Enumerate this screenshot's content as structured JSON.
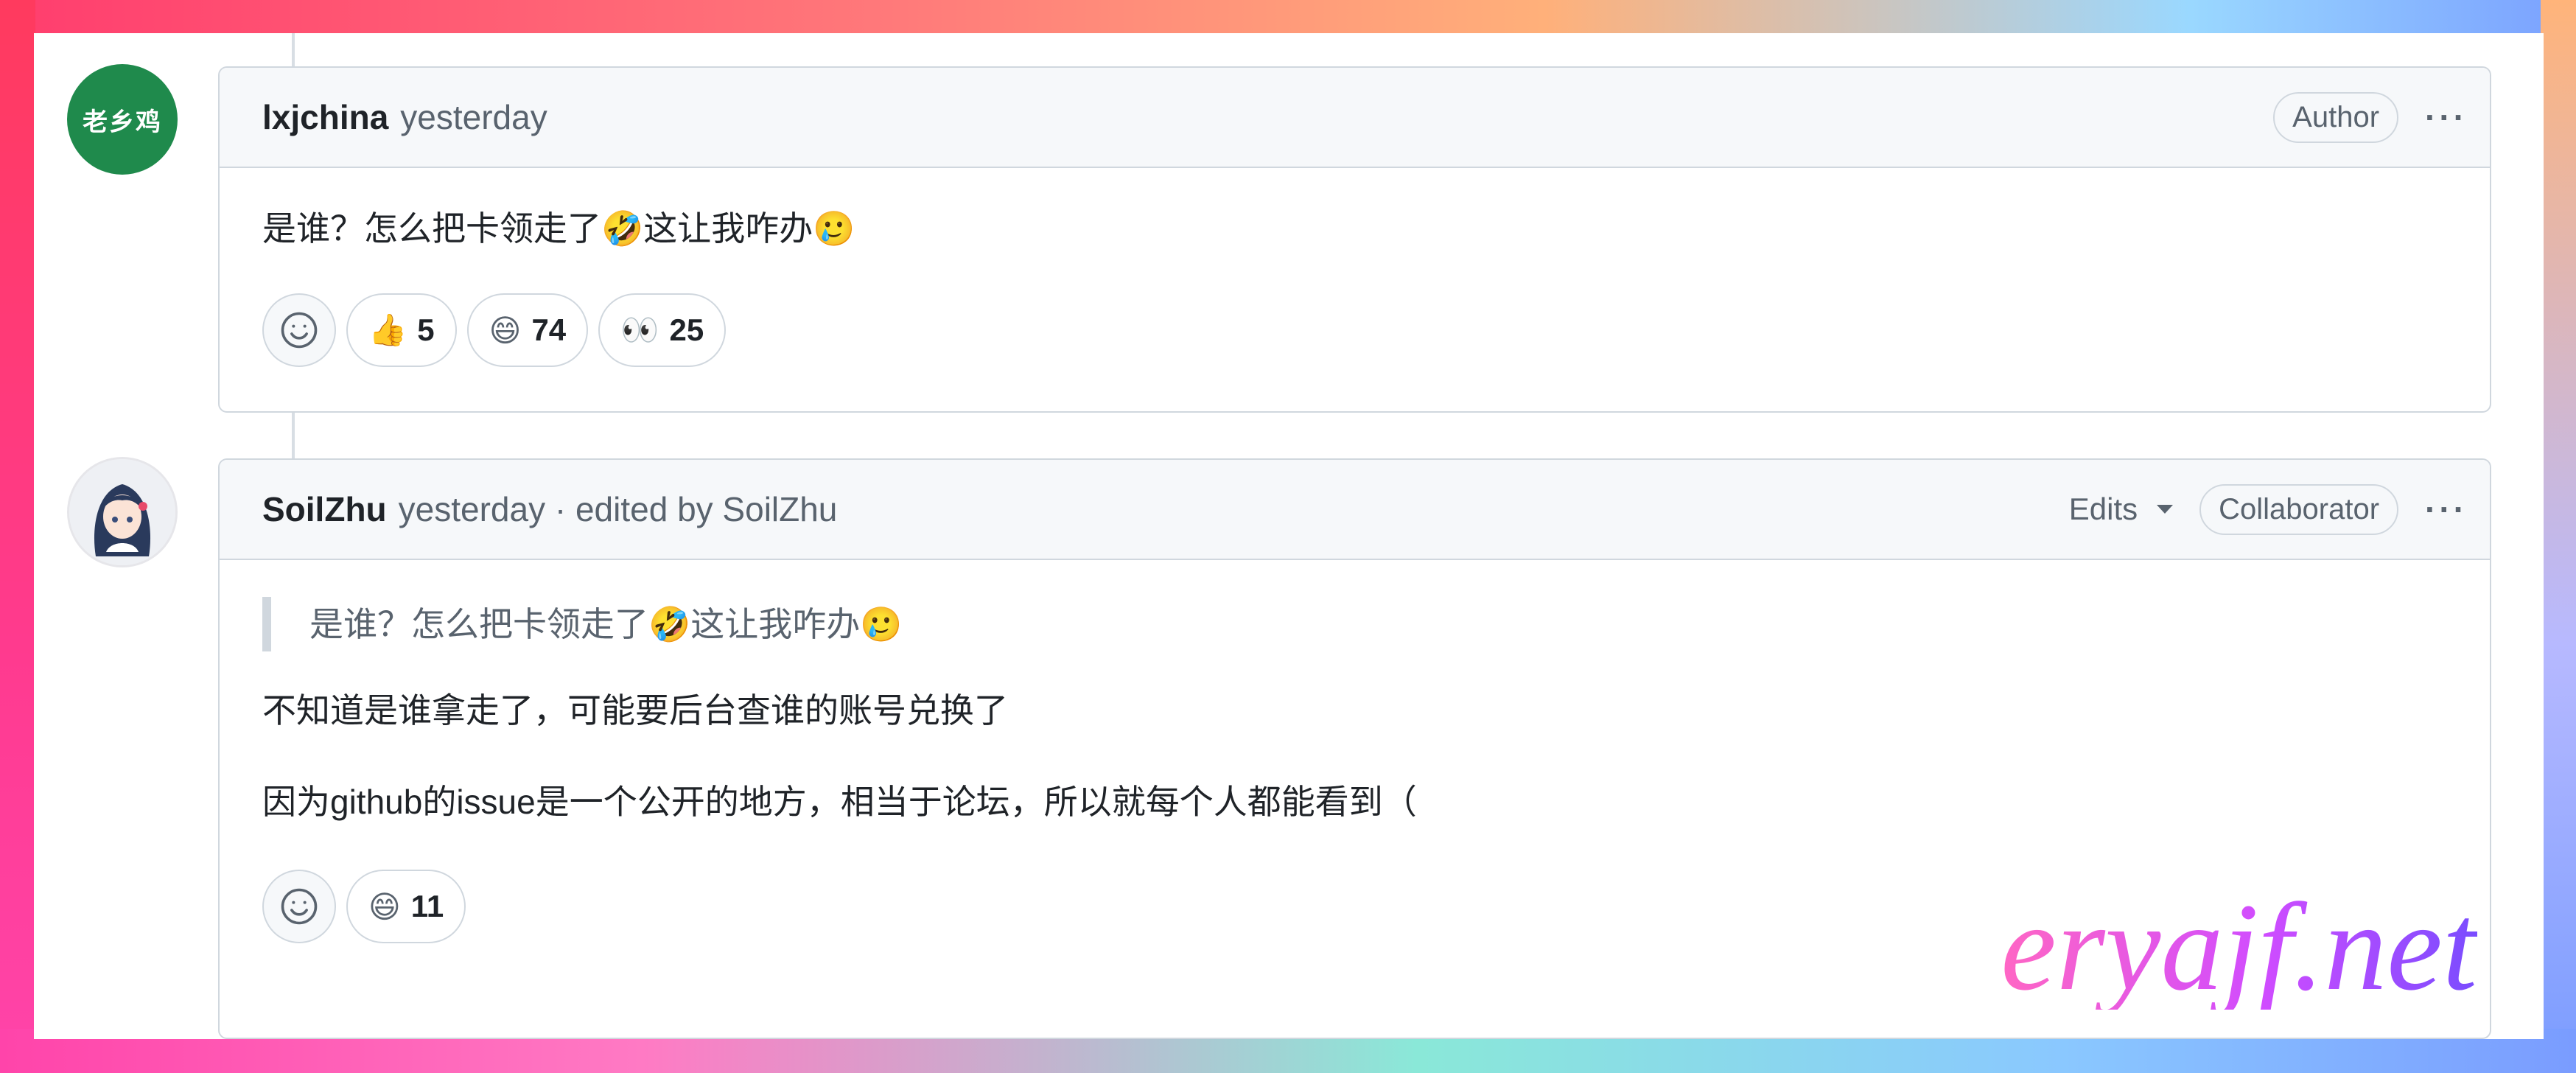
{
  "comments": [
    {
      "author": "lxjchina",
      "avatar_text": "老乡鸡",
      "time": "yesterday",
      "badge": "Author",
      "menu": "···",
      "body": [
        "是谁？怎么把卡领走了🤣这让我咋办🥲"
      ],
      "reactions": [
        {
          "emoji": "👍",
          "count": "5"
        },
        {
          "emoji": "😄",
          "count": "74"
        },
        {
          "emoji": "👀",
          "count": "25"
        }
      ]
    },
    {
      "author": "SoilZhu",
      "time": "yesterday · edited by SoilZhu",
      "edits_label": "Edits",
      "badge": "Collaborator",
      "menu": "···",
      "quote": "是谁？怎么把卡领走了🤣这让我咋办🥲",
      "body": [
        "不知道是谁拿走了，可能要后台查谁的账号兑换了",
        "因为github的issue是一个公开的地方，相当于论坛，所以就每个人都能看到（"
      ],
      "reactions": [
        {
          "emoji": "😄",
          "count": "11"
        }
      ]
    }
  ],
  "watermark": "eryajf.net",
  "colors": {
    "header_bg": "#f6f8fa",
    "border": "#d0d7de",
    "muted_text": "#59636e",
    "avatar1_bg": "#1f8a4c"
  }
}
